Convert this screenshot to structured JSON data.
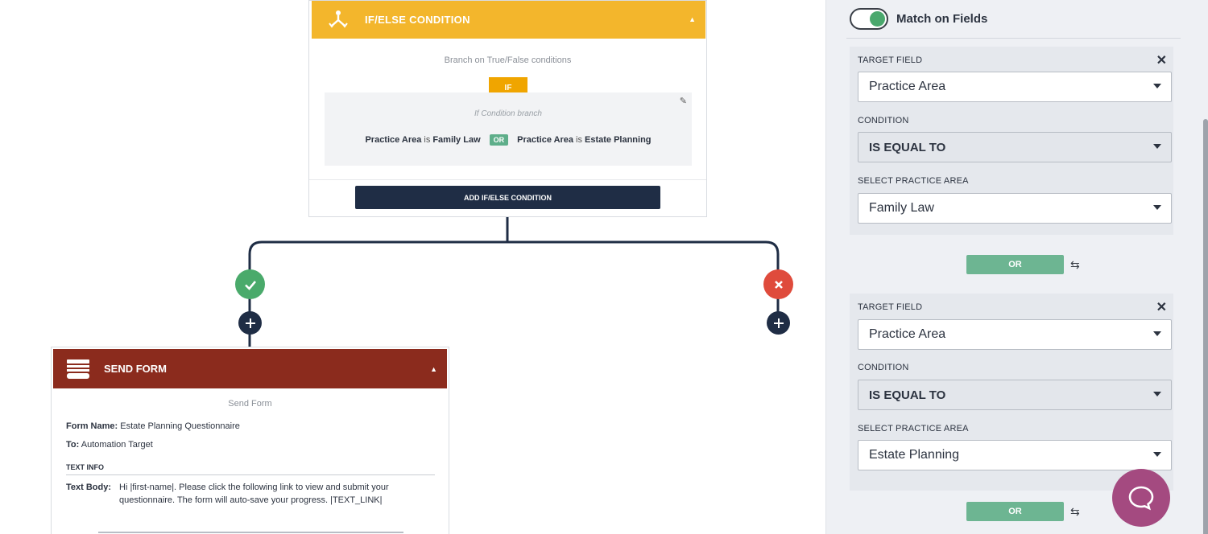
{
  "ifelse": {
    "title": "IF/ELSE CONDITION",
    "subtitle": "Branch on True/False conditions",
    "if_badge": "IF",
    "branch_label": "If Condition branch",
    "conditions": [
      {
        "field": "Practice Area",
        "op": "is",
        "value": "Family Law"
      },
      {
        "field": "Practice Area",
        "op": "is",
        "value": "Estate Planning"
      }
    ],
    "or_label": "OR",
    "add_button": "ADD IF/ELSE CONDITION"
  },
  "send_form": {
    "title": "SEND FORM",
    "subtitle": "Send Form",
    "form_name_key": "Form Name:",
    "form_name_value": "Estate Planning Questionnaire",
    "to_key": "To:",
    "to_value": "Automation Target",
    "section": "TEXT INFO",
    "text_body_key": "Text Body:",
    "text_body_value": "Hi |first-name|. Please click the following link to view and submit your questionnaire. The form will auto-save your progress. |TEXT_LINK|"
  },
  "panel": {
    "toggle_label": "Match on Fields",
    "toggle_on": true,
    "groups": [
      {
        "target_label": "TARGET FIELD",
        "target_value": "Practice Area",
        "condition_label": "CONDITION",
        "condition_value": "IS EQUAL TO",
        "select_label": "SELECT PRACTICE AREA",
        "select_value": "Family Law"
      },
      {
        "target_label": "TARGET FIELD",
        "target_value": "Practice Area",
        "condition_label": "CONDITION",
        "condition_value": "IS EQUAL TO",
        "select_label": "SELECT PRACTICE AREA",
        "select_value": "Estate Planning"
      }
    ],
    "or_button": "OR"
  },
  "colors": {
    "ifelse_header": "#f3b62c",
    "sendform_header": "#8b2b1d",
    "true_branch": "#4aaa6b",
    "false_branch": "#df4b3c",
    "navy": "#1f2d45",
    "or_green": "#6db592",
    "chat": "#a44a80"
  }
}
